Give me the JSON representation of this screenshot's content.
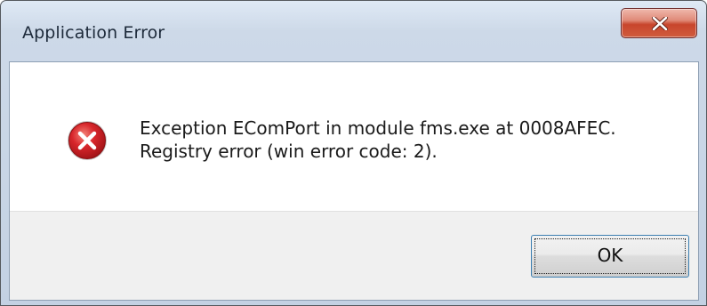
{
  "window": {
    "title": "Application Error",
    "close_icon": "close-icon"
  },
  "dialog": {
    "icon": "error-icon",
    "message_lines": [
      "Exception EComPort in module fms.exe at 0008AFEC.",
      "Registry error (win error code: 2)."
    ],
    "ok_label": "OK"
  },
  "colors": {
    "close_button": "#c8452c",
    "error_icon": "#d8262b",
    "ok_border": "#3c7fb1"
  }
}
